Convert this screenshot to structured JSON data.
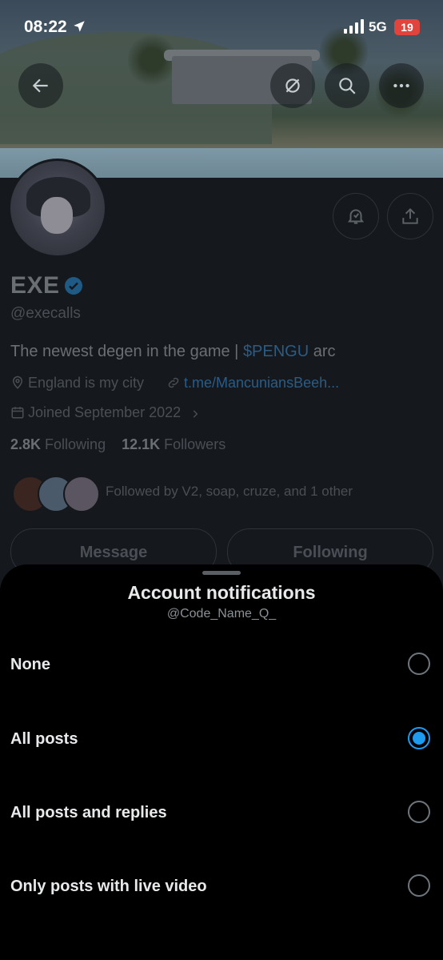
{
  "status_bar": {
    "time": "08:22",
    "network": "5G",
    "battery": "19"
  },
  "profile": {
    "name": "EXE",
    "handle": "@execalls",
    "bio_prefix": "The newest degen in the game | ",
    "bio_tag": "$PENGU",
    "bio_suffix": " arc",
    "location": "England is my city",
    "link": "t.me/MancuniansBeeh...",
    "joined": "Joined September 2022",
    "following_count": "2.8K",
    "following_label": "Following",
    "followers_count": "12.1K",
    "followers_label": "Followers",
    "followed_by": "Followed by V2, soap, cruze, and 1 other",
    "message_button": "Message",
    "following_button": "Following"
  },
  "sheet": {
    "title": "Account notifications",
    "subtitle": "@Code_Name_Q_",
    "options": [
      {
        "label": "None",
        "selected": false
      },
      {
        "label": "All posts",
        "selected": true
      },
      {
        "label": "All posts and replies",
        "selected": false
      },
      {
        "label": "Only posts with live video",
        "selected": false
      }
    ]
  },
  "colors": {
    "accent": "#1d9bf0",
    "background": "#000000"
  }
}
